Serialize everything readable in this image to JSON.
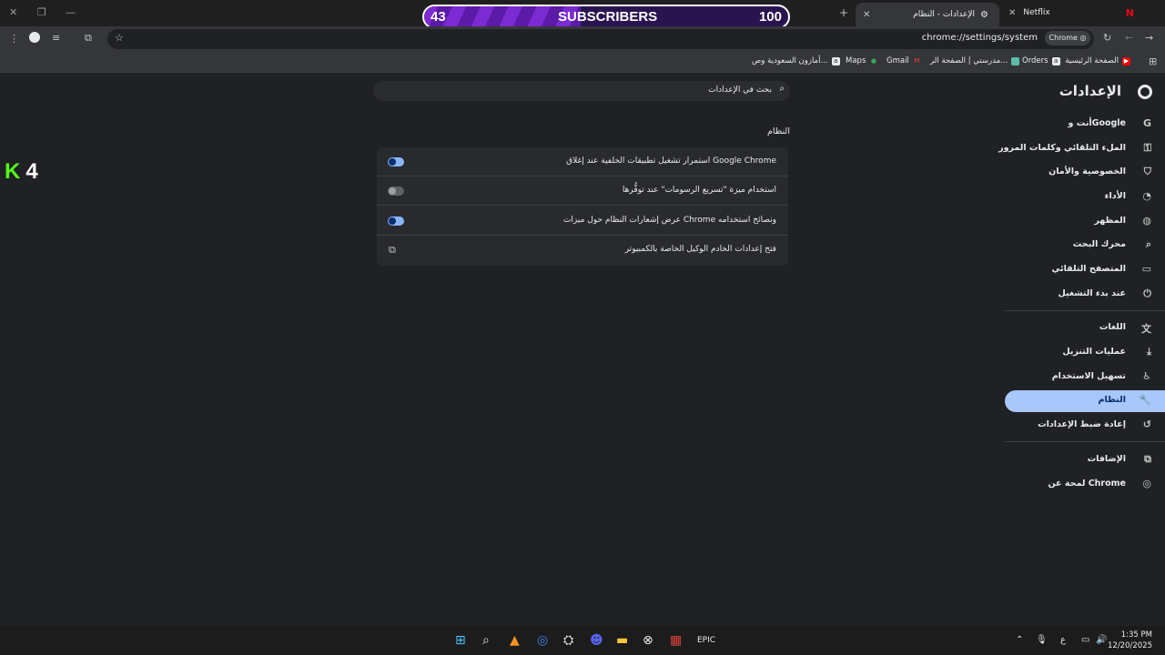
{
  "tabs": [
    {
      "label": "Netflix",
      "favicon": "netflix-icon"
    },
    {
      "label": "الإعدادات - النظام",
      "favicon": "gear-icon"
    }
  ],
  "subscriber_counter": {
    "current": "43",
    "label": "SUBSCRIBERS",
    "goal": "100",
    "progress": 0.43
  },
  "toolbar": {
    "url": "chrome://settings/system",
    "chip": "Chrome"
  },
  "bookmarks": [
    {
      "label": "الصفحة الرئيسية",
      "icon": "youtube-icon"
    },
    {
      "label": "Orders",
      "icon": "amazon-icon"
    },
    {
      "label": "مدرستي | الصفحة الر...",
      "icon": "madrasati-icon"
    },
    {
      "label": "Gmail",
      "icon": "gmail-icon"
    },
    {
      "label": "Maps",
      "icon": "maps-icon"
    },
    {
      "label": "أمازون السعودية وص...",
      "icon": "amazon-icon"
    }
  ],
  "settings": {
    "title": "الإعدادات",
    "search_placeholder": "بحث في الإعدادات",
    "nav": [
      {
        "label": "أنت وGoogle",
        "icon": "google-icon"
      },
      {
        "label": "الملء التلقائي وكلمات المرور",
        "icon": "key-icon"
      },
      {
        "label": "الخصوصية والأمان",
        "icon": "shield-icon"
      },
      {
        "label": "الأداء",
        "icon": "speedometer-icon"
      },
      {
        "label": "المظهر",
        "icon": "palette-icon"
      },
      {
        "label": "محرك البحث",
        "icon": "search-icon"
      },
      {
        "label": "المتصفح التلقائي",
        "icon": "browser-icon"
      },
      {
        "label": "عند بدء التشغيل",
        "icon": "power-icon"
      },
      {
        "label": "اللغات",
        "icon": "translate-icon"
      },
      {
        "label": "عمليات التنزيل",
        "icon": "download-icon"
      },
      {
        "label": "تسهيل الاستخدام",
        "icon": "accessibility-icon"
      },
      {
        "label": "النظام",
        "icon": "wrench-icon",
        "active": true
      },
      {
        "label": "إعادة ضبط الإعدادات",
        "icon": "reset-icon"
      },
      {
        "label": "الإضافات",
        "icon": "extensions-icon"
      },
      {
        "label": "لمحة عن Chrome",
        "icon": "chrome-icon"
      }
    ],
    "section_title": "النظام",
    "rows": [
      {
        "label": "استمرار تشغيل تطبيقات الخلفية عند إغلاق Google Chrome",
        "control": "toggle",
        "on": true
      },
      {
        "label": "استخدام ميزة \"تسريع الرسومات\" عند توفُّرها",
        "control": "toggle",
        "on": false
      },
      {
        "label": "عرض إشعارات النظام حول ميزات Chrome ونصائح استخدامه",
        "control": "toggle",
        "on": true
      },
      {
        "label": "فتح إعدادات الخادم الوكيل الخاصة بالكمبيوتر",
        "control": "external-link"
      }
    ]
  },
  "overlay": {
    "kick_number": "4"
  },
  "taskbar": {
    "time": "1:35 PM",
    "date": "12/20/2025",
    "lang": "ع"
  }
}
